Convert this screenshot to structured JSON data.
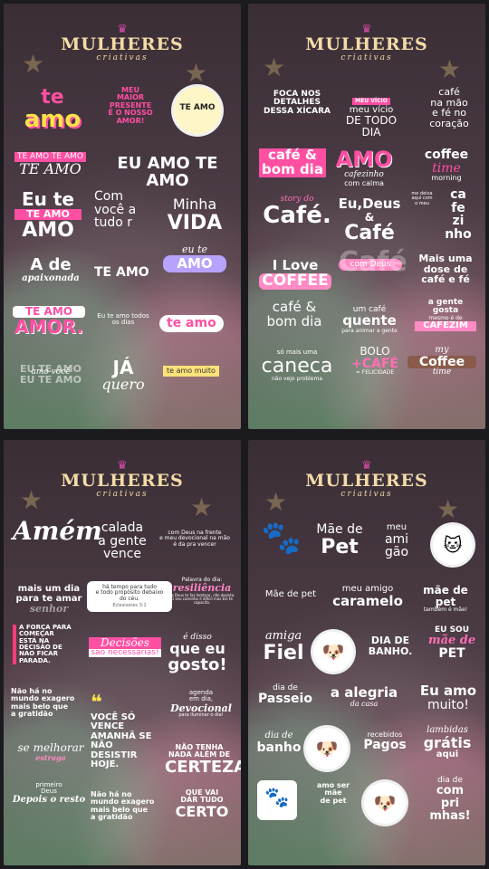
{
  "brand": {
    "name": "MULHERES",
    "sub": "criativas",
    "crown": "♛"
  },
  "panel1": {
    "teamo_te": "te",
    "teamo_amo": "amo",
    "meu_maior": "MEU\nMAIOR\nPRESENTE\nÉ O NOSSO\nAMOR!",
    "circle_text": "TE AMO",
    "teamo_teamo": "TE AMO TE AMO",
    "teamo_script": "TE AMO",
    "eu_amo_te_amo": "EU AMO TE AMO",
    "eu_te_amo_1": "Eu te",
    "eu_te_amo_2": "TE AMO",
    "eu_te_amo_3": "AMO",
    "com_voce": "Com\nvocê   a\ntudo   r",
    "minha_vida_1": "Minha",
    "minha_vida_2": "VIDA",
    "a_de": "A de",
    "apaixonada": "apaixonada",
    "te_amo_bold": "TE AMO",
    "eu_te_top": "eu te",
    "amo_bubble": "AMO",
    "te_amo_amor_1": "TE AMO",
    "te_amo_amor_2": "AMOR.",
    "eu_te_amo_todos": "Eu te amo todos\nos dias",
    "te_amo_pink": "te amo",
    "eu_te_amo_block": "EU TE AMO\nEU TE AMO",
    "amo_voce": "amo você",
    "ja_quero_1": "JÁ",
    "ja_quero_2": "quero",
    "te_amo_muito": "te amo muito"
  },
  "panel2": {
    "foca": "FOCA NOS\nDETALHES\nDESSA XÍCARA",
    "meu_vicio_small": "MEU VÍCIO",
    "meu_vicio_1": "meu vício",
    "meu_vicio_2": "DE TODO DIA",
    "cafe_mao": "café\nna mão\ne fé no\ncoração",
    "cafe_bom_dia_1": "café &",
    "cafe_bom_dia_2": "bom dia",
    "amo_1": "AMO",
    "amo_2": "cafezinho",
    "amo_3": "com calma",
    "coffee_time_1": "coffee",
    "coffee_time_2": "time",
    "coffee_time_3": "morning",
    "story": "story do",
    "cafe_big": "Café.",
    "eu_deus_1": "Eu,Deus",
    "eu_deus_2": "&",
    "eu_deus_3": "Café",
    "me_deixa": "me deixa\naqui com\no meu",
    "cafezinho_v": "ca\nfe\nzi\nnho",
    "i_love_1": "I Love",
    "i_love_2": "COFFEE",
    "cafe_deus_big": "Café",
    "com_deus": "com Deus",
    "mais_uma": "Mais uma\ndose de\ncafé e fé",
    "cafe_bom_dia2_1": "café &",
    "cafe_bom_dia2_2": "bom dia",
    "um_cafe_1": "um café",
    "um_cafe_2": "quente",
    "um_cafe_3": "para animar a gente",
    "a_gente": "a gente\ngosta",
    "mesmo": "mesmo é de",
    "cafezim": "CAFEZIM",
    "so_mais": "só mais uma",
    "caneca": "caneca",
    "nao_vejo": "não vejo problema",
    "bolo": "BOLO",
    "mais_cafe": "+CAFÉ",
    "felicidade": "= FELICIDADE",
    "my_coffee_1": "my",
    "my_coffee_2": "Coffee",
    "my_coffee_3": "time"
  },
  "panel3": {
    "amem": "Amém",
    "calada": "calada\na gente\nvence",
    "com_deus_frente": "com Deus na frente\ne meu devocional na mão\né da pra vencer",
    "mais_um_dia": "mais um dia\npara te amar",
    "senhor": "senhor",
    "ha_tempo": "há tempo para tudo\ne todo propósito debaixo\ndo céu.",
    "eclesiastes": "Eclesiastes 3:1",
    "palavra": "Palavra do dia:",
    "resiliencia": "resiliência",
    "resil_body": "Se Deus te faz lembrar, não desista. O seu caminho é difícil mas Ele te capacita.",
    "forca": "A FORÇA PARA\nCOMEÇAR\nESTÁ NA\nDECISÃO DE\nNÃO FICAR\nPARADA.",
    "decisoes_1": "Decisões",
    "decisoes_2": "são necessárias!",
    "e_disso_1": "é disso",
    "e_disso_2": "que eu",
    "e_disso_3": "gosto!",
    "nao_ha_1": "Não há no\nmundo exagero\nmais belo que\na gratidão",
    "voce_so": "VOCÊ SÓ\nVENCE\nAMANHÃ SE\nNÃO\nDESISTIR\nHOJE.",
    "agenda": "agenda\nem dia,",
    "devocional": "Devocional",
    "para": "para iluminar o dia!",
    "se_melhorar": "se melhorar",
    "estraga": "estraga",
    "nao_tenha": "NÃO TENHA\nNADA ALÉM DE",
    "certeza": "CERTEZA",
    "primeiro": "primeiro",
    "deus": "Deus",
    "depois": "Depois o resto",
    "nao_ha_2": "Não há no\nmundo exagero\nmais belo que\na gratidão",
    "que_vai": "QUE VAI\nDAR TUDO",
    "certo": "CERTO"
  },
  "panel4": {
    "mae_de_1": "Mãe de",
    "mae_de_2": "Pet",
    "meu_amigao_1": "meu",
    "meu_amigao_2": "ami\ngão",
    "mae_pet_small": "Mãe de pet",
    "meu_amigo": "meu amigo",
    "caramelo": "caramelo",
    "mae_pet_2": "mãe de pet",
    "tambem": "também é mãe!",
    "amiga_1": "amiga",
    "amiga_2": "Fiel",
    "dia_banho": "DIA DE\nBANHO.",
    "eu_sou_1": "EU SOU",
    "eu_sou_2": "mãe de",
    "eu_sou_3": "PET",
    "dia_passeio_1": "dia de",
    "dia_passeio_2": "Passeio",
    "alegria_1": "a alegria",
    "alegria_2": "da casa",
    "eu_amo_1": "Eu amo",
    "eu_amo_2": "muito!",
    "dia_banho2_1": "dia de",
    "dia_banho2_2": "banho",
    "recebidos": "recebidos",
    "pagos": "Pagos",
    "lambidas": "lambidas",
    "gratis": "grátis",
    "aqui": "aqui",
    "amo_ser": "amo ser\nmãe\nde pet",
    "dia_de_compras_1": "dia de",
    "dia_de_compras_2": "com\npri\nmhas!"
  }
}
